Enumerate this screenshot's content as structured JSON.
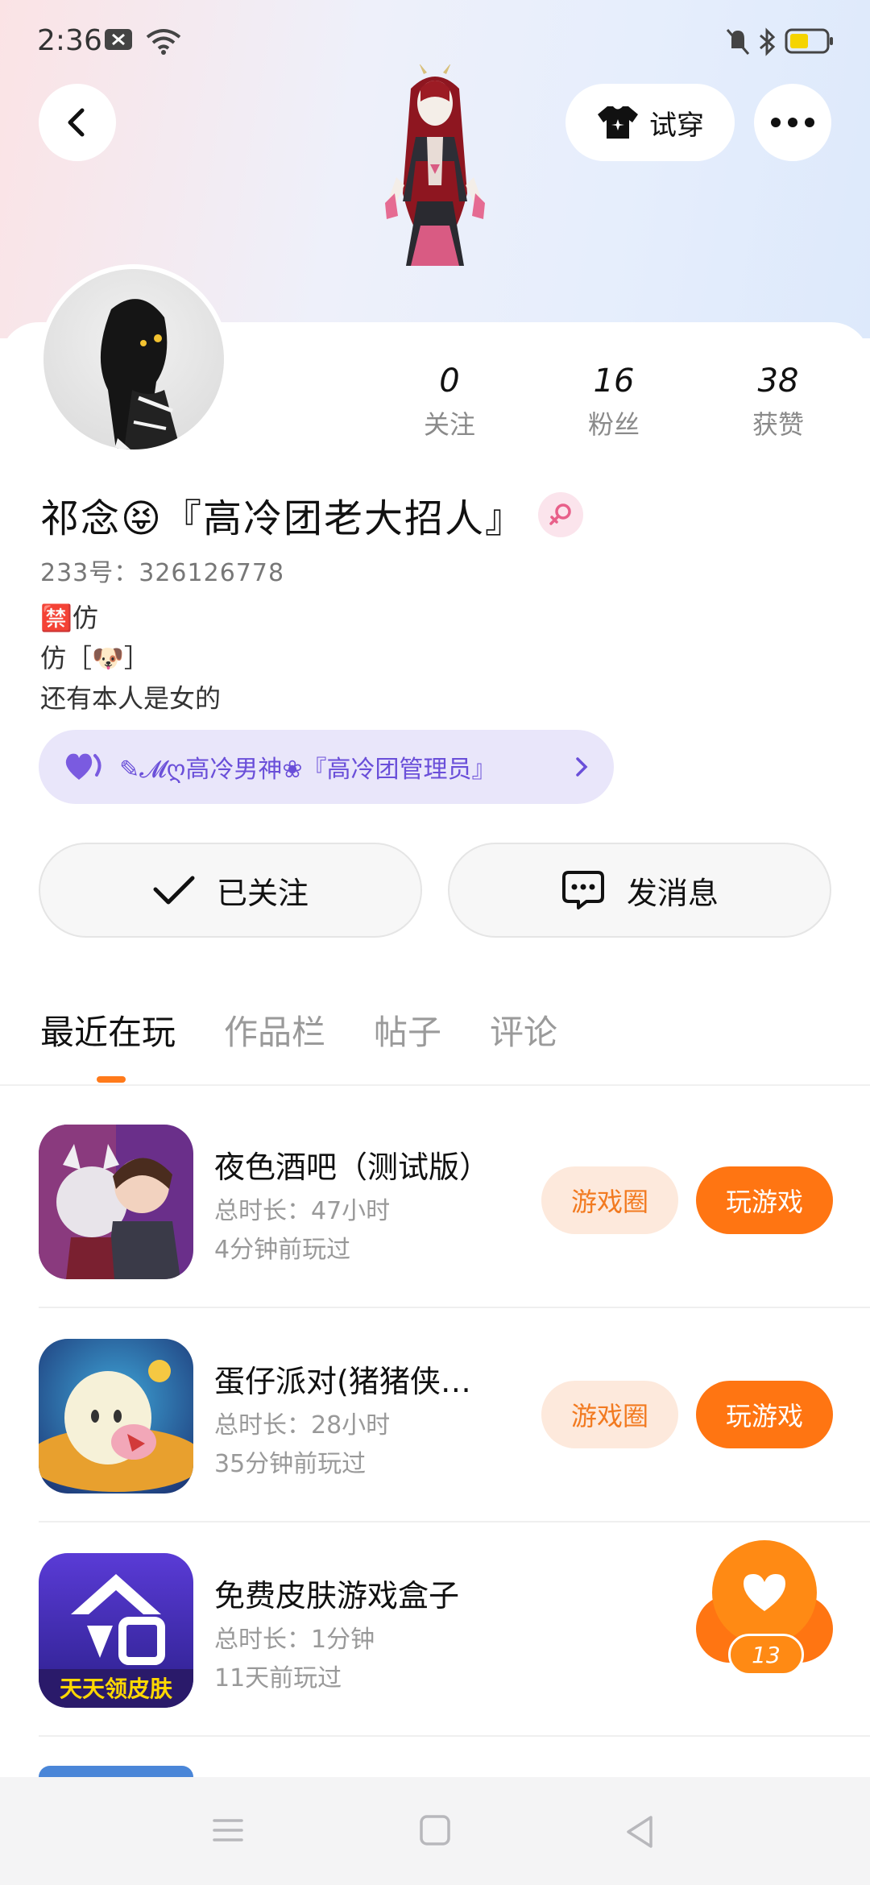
{
  "status_bar": {
    "time": "2:36"
  },
  "header": {
    "try_on_label": "试穿"
  },
  "profile": {
    "name": "祁念😝『高冷团老大招人』",
    "uid": "233号：326126778",
    "bio_lines": [
      "🈲仿",
      "仿［🐶］",
      "还有本人是女的"
    ],
    "stats": [
      {
        "value": "0",
        "label": "关注"
      },
      {
        "value": "16",
        "label": "粉丝"
      },
      {
        "value": "38",
        "label": "获赞"
      }
    ],
    "guild_text": "✎𝓜ღ高冷男神❀『高冷团管理员』"
  },
  "actions": {
    "follow_label": "已关注",
    "message_label": "发消息"
  },
  "tabs": [
    "最近在玩",
    "作品栏",
    "帖子",
    "评论"
  ],
  "games": [
    {
      "title": "夜色酒吧（测试版）",
      "duration": "总时长：47小时",
      "last_played": "4分钟前玩过",
      "circle_label": "游戏圈",
      "play_label": "玩游戏"
    },
    {
      "title": "蛋仔派对(猪猪侠…",
      "duration": "总时长：28小时",
      "last_played": "35分钟前玩过",
      "circle_label": "游戏圈",
      "play_label": "玩游戏"
    },
    {
      "title": "免费皮肤游戏盒子",
      "duration": "总时长：1分钟",
      "last_played": "11天前玩过",
      "icon_text": "天天领皮肤"
    }
  ],
  "favorite": {
    "count": "13"
  },
  "colors": {
    "accent": "#ff7512",
    "guild_bg": "#e9e6fa",
    "guild_text": "#6a4fd9"
  }
}
